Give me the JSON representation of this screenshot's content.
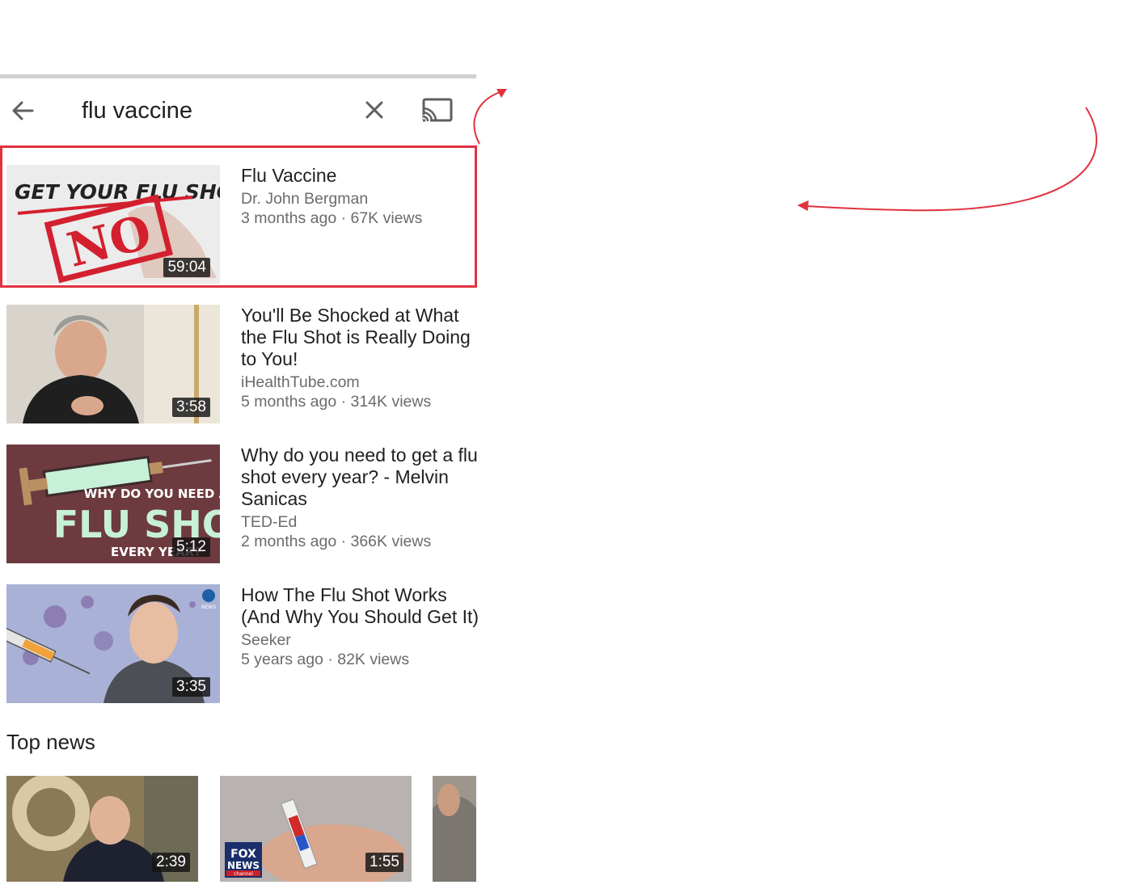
{
  "search": {
    "query": "flu vaccine",
    "back_icon": "arrow-left-icon",
    "clear_icon": "close-icon",
    "cast_icon": "cast-icon"
  },
  "results": [
    {
      "title": "Flu Vaccine",
      "channel": "Dr. John Bergman",
      "meta": "3 months ago · 67K views",
      "duration": "59:04",
      "thumb_text_top": "GET YOUR FLU SHOT",
      "thumb_text_stamp": "NO"
    },
    {
      "title": "You'll Be Shocked at What the Flu Shot is Really Doing to You!",
      "channel": "iHealthTube.com",
      "meta": "5 months ago · 314K views",
      "duration": "3:58"
    },
    {
      "title": "Why do you need to get a flu shot every year? - Melvin Sanicas",
      "channel": "TED-Ed",
      "meta": "2 months ago · 366K views",
      "duration": "5:12",
      "thumb_text_line1": "WHY DO YOU NEED A",
      "thumb_text_line2": "FLU SHOT",
      "thumb_text_line3": "EVERY YEAR?"
    },
    {
      "title": "How The Flu Shot Works (And Why You Should Get It)",
      "channel": "Seeker",
      "meta": "5 years ago · 82K views",
      "duration": "3:35",
      "thumb_logo_text": "NEWS"
    }
  ],
  "top_news": {
    "title": "Top news",
    "items": [
      {
        "duration": "2:39"
      },
      {
        "duration": "1:55",
        "logo_line1": "FOX",
        "logo_line2": "NEWS",
        "logo_line3": "channel"
      },
      {
        "duration": ""
      }
    ]
  },
  "colors": {
    "highlight": "#e0323f",
    "ted_background": "#6d3a3f",
    "ted_text": "#c7f0d8"
  }
}
